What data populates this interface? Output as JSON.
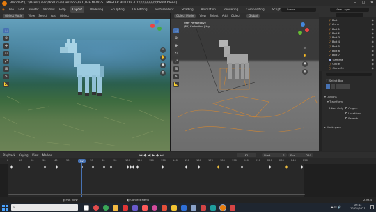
{
  "titlebar": {
    "title": "Blender* [C:\\Users\\user\\OneDrive\\Desktop\\ART\\THE NEWEST MASTER BUILD F 4 1\\\\\\\\\\\\\\\\\\\\\\\\\\\\\\\\\\\\blend.blend]",
    "min": "–",
    "max": "□",
    "close": "✕"
  },
  "menubar": {
    "items": [
      "File",
      "Edit",
      "Render",
      "Window",
      "Help"
    ],
    "workspaces": [
      "Layout",
      "Modeling",
      "Sculpting",
      "UV Editing",
      "Texture Paint",
      "Shading",
      "Animation",
      "Rendering",
      "Compositing",
      "Scripting"
    ],
    "active_workspace": "Layout",
    "scene": "Scene",
    "view_layer": "View Layer"
  },
  "viewport_left": {
    "mode": "Object Mode",
    "menus": [
      "View",
      "Select",
      "Add",
      "Object"
    ],
    "transform": "Global"
  },
  "viewport_right": {
    "mode": "Object Mode",
    "menus": [
      "View",
      "Select",
      "Add",
      "Object"
    ],
    "transform": "Global",
    "overlay_line1": "User Perspective",
    "overlay_line2": "(82) Collection | Hg"
  },
  "outliner": {
    "rows": [
      {
        "label": "Bolt"
      },
      {
        "label": "Arms"
      },
      {
        "label": "Bolt 1"
      },
      {
        "label": "Bolt 2"
      },
      {
        "label": "Bolt 3"
      },
      {
        "label": "Bolt 4"
      },
      {
        "label": "Bolt 5"
      },
      {
        "label": "Bolt 6"
      },
      {
        "label": "Bolt 7"
      },
      {
        "label": "Camera"
      },
      {
        "label": "Circle"
      },
      {
        "label": "Circle 01"
      }
    ]
  },
  "properties": {
    "search": "",
    "select_box": "Select Box",
    "options": "Options",
    "transform": "Transform",
    "affect_only": "Affect Only",
    "checks": [
      "Origins",
      "Locations",
      "Parents"
    ],
    "workspace": "Workspace"
  },
  "timeline": {
    "menus": [
      "Playback",
      "Keying",
      "View",
      "Marker"
    ],
    "current_frame": "82",
    "start_label": "Start",
    "start": "1",
    "end_label": "End",
    "end": "250",
    "ticks": [
      "0",
      "10",
      "20",
      "30",
      "40",
      "50",
      "60",
      "70",
      "80",
      "90",
      "100",
      "110",
      "120",
      "130",
      "140",
      "150",
      "160",
      "170",
      "180",
      "190",
      "200",
      "210",
      "220",
      "230",
      "240",
      "250"
    ],
    "playhead": "82"
  },
  "statusbar": {
    "left": "Pan View",
    "mid": "Context Menu",
    "version": "2.93.4"
  },
  "taskbar": {
    "time": "09:43",
    "date": "12/02/2021"
  },
  "colors": {
    "accent": "#4772b3",
    "orange": "#e89a3c",
    "keyframe_selected": "#f0c040"
  }
}
